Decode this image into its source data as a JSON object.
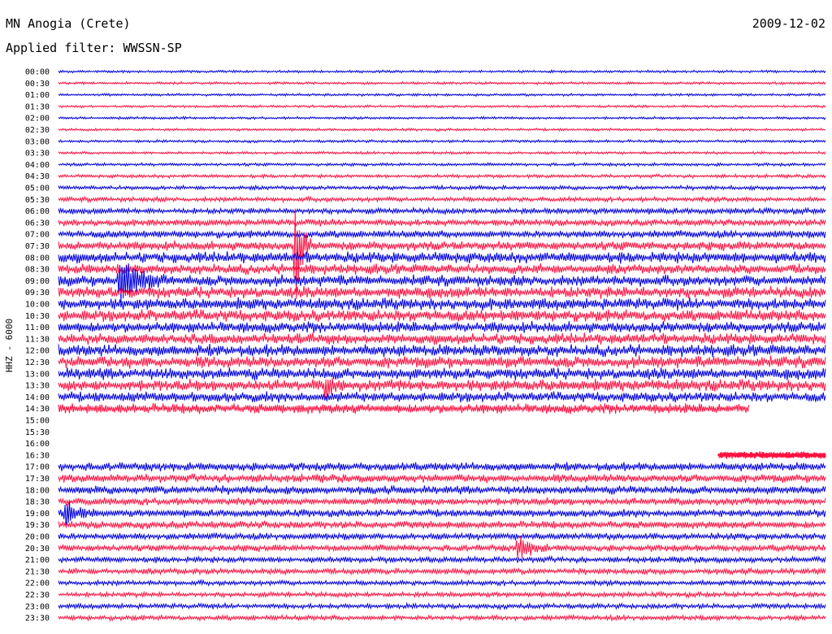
{
  "header": {
    "station": "MN Anogia (Crete)",
    "date": "2009-12-02",
    "filter": "Applied filter: WWSSN-SP"
  },
  "chart_data": {
    "type": "line",
    "title": "MN Anogia (Crete)",
    "ylabel": "HHZ - 6000",
    "colors": [
      "#0000dd",
      "#ff1040"
    ],
    "time_labels": [
      "00:00",
      "00:30",
      "01:00",
      "01:30",
      "02:00",
      "02:30",
      "03:00",
      "03:30",
      "04:00",
      "04:30",
      "05:00",
      "05:30",
      "06:00",
      "06:30",
      "07:00",
      "07:30",
      "08:00",
      "08:30",
      "09:00",
      "09:30",
      "10:00",
      "10:30",
      "11:00",
      "11:30",
      "12:00",
      "12:30",
      "13:00",
      "13:30",
      "14:00",
      "14:30",
      "15:00",
      "15:30",
      "16:00",
      "16:30",
      "17:00",
      "17:30",
      "18:00",
      "18:30",
      "19:00",
      "19:30",
      "20:00",
      "20:30",
      "21:00",
      "21:30",
      "22:00",
      "22:30",
      "23:00",
      "23:30"
    ],
    "rows": [
      {
        "amp": 1.5
      },
      {
        "amp": 1.5
      },
      {
        "amp": 1.5
      },
      {
        "amp": 1.5
      },
      {
        "amp": 1.5
      },
      {
        "amp": 1.5
      },
      {
        "amp": 1.6
      },
      {
        "amp": 1.6
      },
      {
        "amp": 1.8
      },
      {
        "amp": 2.0
      },
      {
        "amp": 2.4
      },
      {
        "amp": 2.8
      },
      {
        "amp": 3.5
      },
      {
        "amp": 4.0
      },
      {
        "amp": 4.5
      },
      {
        "amp": 5.5
      },
      {
        "amp": 6.5
      },
      {
        "amp": 6.0
      },
      {
        "amp": 6.5
      },
      {
        "amp": 7.0
      },
      {
        "amp": 7.0
      },
      {
        "amp": 7.0
      },
      {
        "amp": 6.5
      },
      {
        "amp": 6.5
      },
      {
        "amp": 7.0
      },
      {
        "amp": 7.0
      },
      {
        "amp": 7.0
      },
      {
        "amp": 7.0
      },
      {
        "amp": 6.0
      },
      {
        "amp": 6.0,
        "end": 0.9
      },
      {
        "amp": 0
      },
      {
        "amp": 0
      },
      {
        "amp": 0
      },
      {
        "amp": 4.0,
        "start": 0.86
      },
      {
        "amp": 5.0
      },
      {
        "amp": 5.0
      },
      {
        "amp": 5.0
      },
      {
        "amp": 4.5
      },
      {
        "amp": 4.5
      },
      {
        "amp": 4.5
      },
      {
        "amp": 4.0
      },
      {
        "amp": 4.0
      },
      {
        "amp": 3.5
      },
      {
        "amp": 3.5
      },
      {
        "amp": 3.0
      },
      {
        "amp": 3.0
      },
      {
        "amp": 3.0
      },
      {
        "amp": 3.0
      }
    ],
    "events": [
      {
        "row": 18,
        "x": 0.08,
        "amp": 30,
        "duration": 0.06
      },
      {
        "row": 15,
        "x": 0.31,
        "amp": 70,
        "duration": 0.02
      },
      {
        "row": 27,
        "x": 0.35,
        "amp": 15,
        "duration": 0.02
      },
      {
        "row": 38,
        "x": 0.01,
        "amp": 15,
        "duration": 0.04
      },
      {
        "row": 41,
        "x": 0.6,
        "amp": 15,
        "duration": 0.04
      }
    ]
  }
}
